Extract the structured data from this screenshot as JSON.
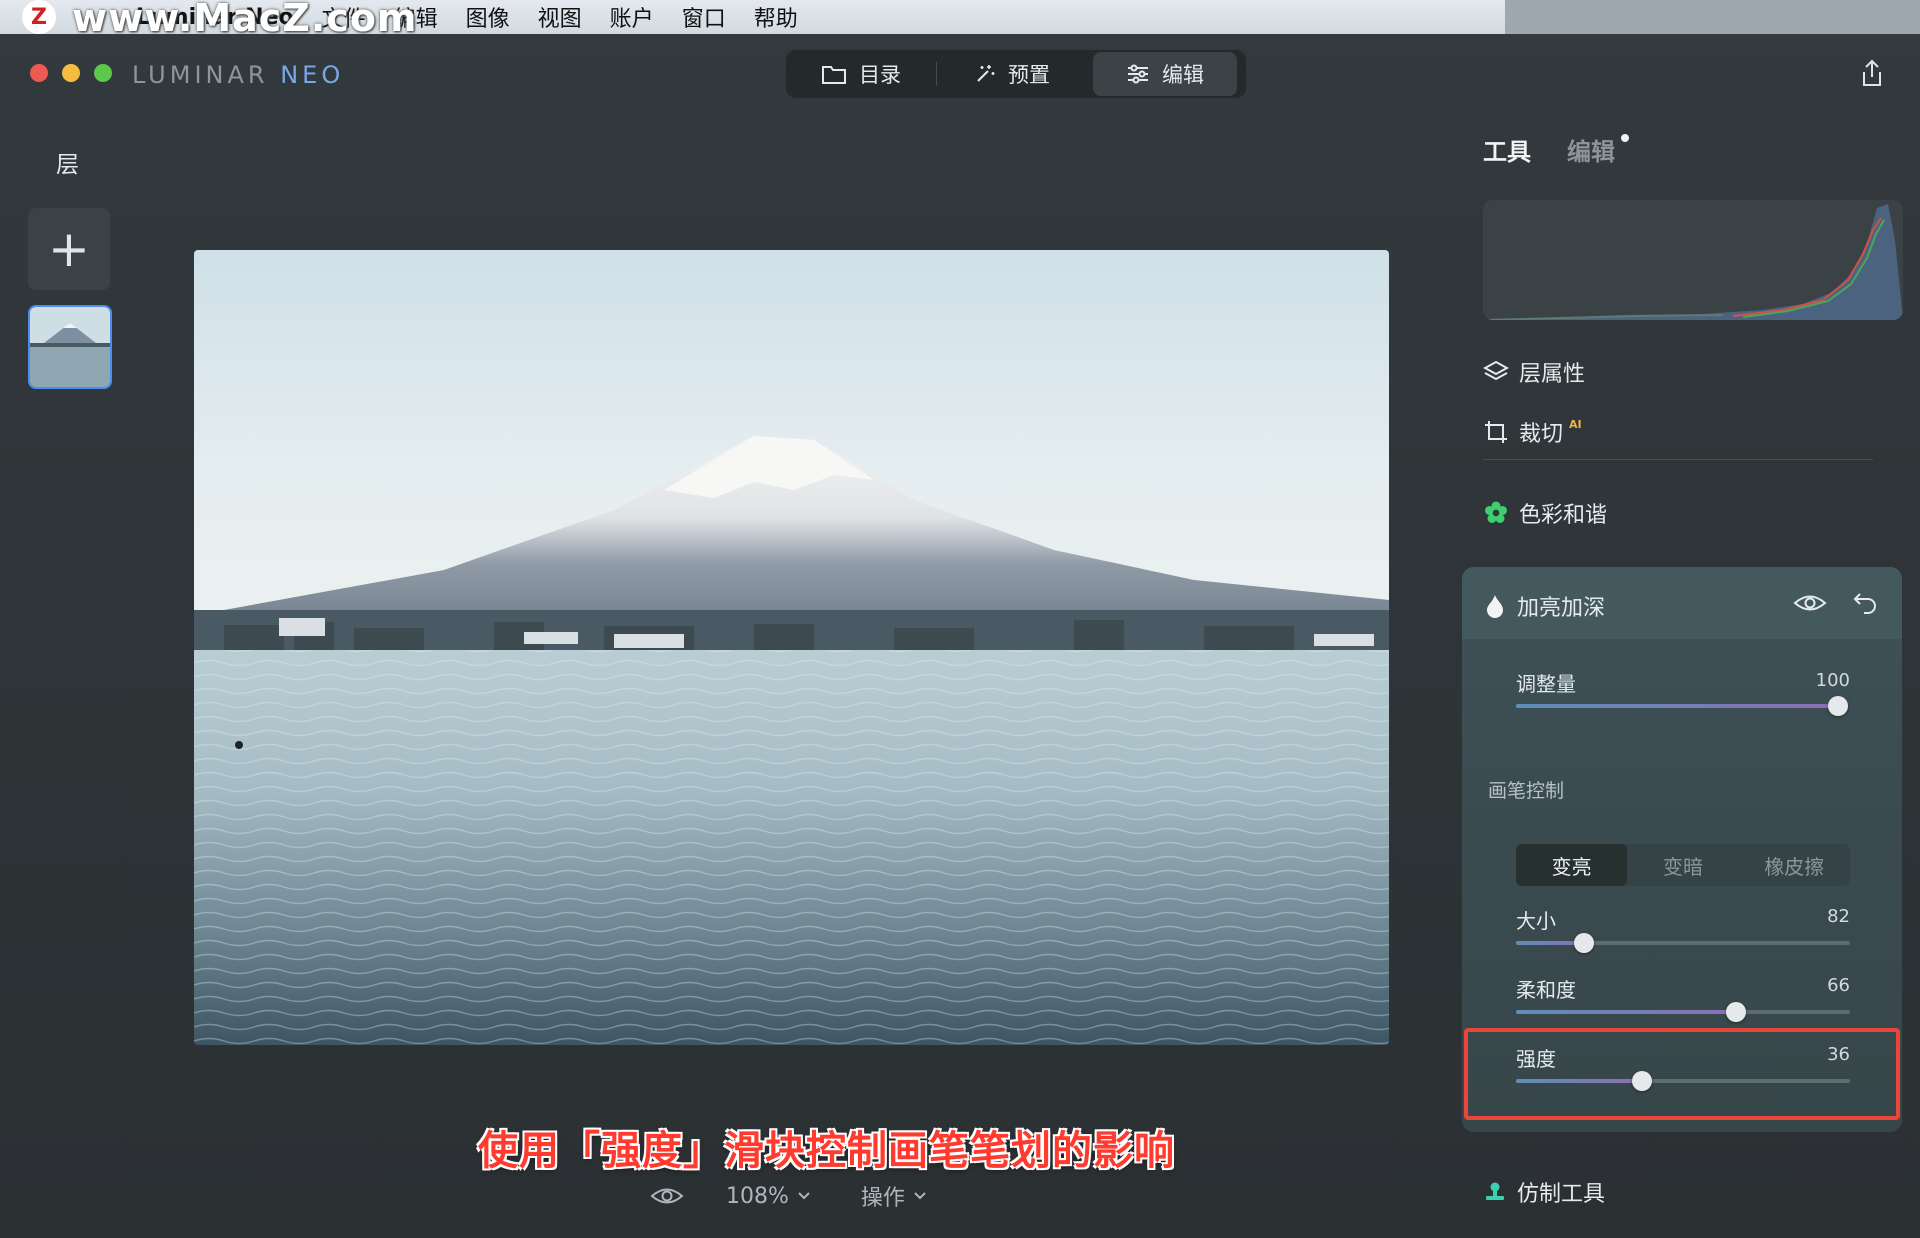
{
  "menubar": {
    "watermark": "www.MacZ.com",
    "app_name": "Luminar Neo",
    "items": [
      "文件",
      "编辑",
      "图像",
      "视图",
      "账户",
      "窗口",
      "帮助"
    ]
  },
  "brand": {
    "main": "LUMINAR",
    "accent": "NEO"
  },
  "segtabs": [
    {
      "label": "目录",
      "icon": "folder-icon"
    },
    {
      "label": "预置",
      "icon": "magic-wand-icon"
    },
    {
      "label": "编辑",
      "icon": "sliders-icon"
    }
  ],
  "layers": {
    "title": "层",
    "add_symbol": "+"
  },
  "caption": "使用「强度」滑块控制画笔笔划的影响",
  "bottombar": {
    "zoom": "108%",
    "actions": "操作"
  },
  "right_panel": {
    "tab_tools": "工具",
    "tab_edits": "编辑",
    "layer_properties": "层属性",
    "crop": "裁切",
    "crop_badge": "AI",
    "color_harmony": "色彩和谐",
    "dodge_burn": {
      "title": "加亮加深",
      "amount": {
        "label": "调整量",
        "value": "100",
        "fraction": 1.0
      },
      "brush_control": "画笔控制",
      "modes": [
        "变亮",
        "变暗",
        "橡皮擦"
      ],
      "active_mode": "变亮",
      "size": {
        "label": "大小",
        "value": "82",
        "fraction": 0.2
      },
      "softness": {
        "label": "柔和度",
        "value": "66",
        "fraction": 0.66
      },
      "strength": {
        "label": "强度",
        "value": "36",
        "fraction": 0.36
      }
    },
    "clone_tool": "仿制工具"
  },
  "colors": {
    "accent_blue": "#4a8ff0",
    "highlight_red": "#e9453a",
    "color_harmony_green": "#3ecf6e"
  }
}
